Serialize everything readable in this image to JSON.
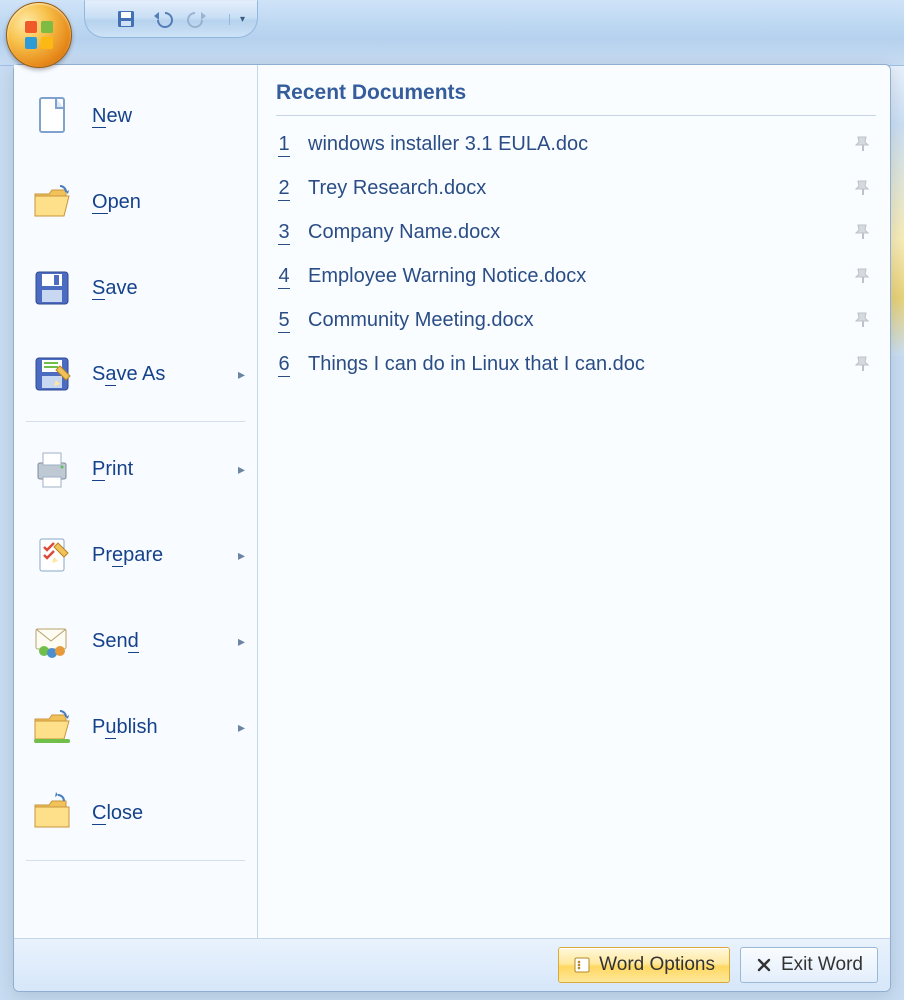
{
  "menu": {
    "items": [
      {
        "label": "New",
        "accel": "N",
        "has_subitems": false,
        "icon": "new-doc"
      },
      {
        "label": "Open",
        "accel": "O",
        "has_subitems": false,
        "icon": "open-folder"
      },
      {
        "label": "Save",
        "accel": "S",
        "has_subitems": false,
        "icon": "save-floppy"
      },
      {
        "label": "Save As",
        "accel": "A",
        "has_subitems": true,
        "icon": "save-as"
      },
      {
        "label": "Print",
        "accel": "P",
        "has_subitems": true,
        "icon": "printer"
      },
      {
        "label": "Prepare",
        "accel": "e",
        "has_subitems": true,
        "icon": "prepare"
      },
      {
        "label": "Send",
        "accel": "d",
        "has_subitems": true,
        "icon": "send"
      },
      {
        "label": "Publish",
        "accel": "u",
        "has_subitems": true,
        "icon": "publish"
      },
      {
        "label": "Close",
        "accel": "C",
        "has_subitems": false,
        "icon": "close-folder"
      }
    ],
    "separators_after": [
      3,
      8
    ]
  },
  "recent_documents": {
    "title": "Recent Documents",
    "items": [
      {
        "index": "1",
        "name": "windows installer 3.1 EULA.doc"
      },
      {
        "index": "2",
        "name": "Trey Research.docx"
      },
      {
        "index": "3",
        "name": "Company Name.docx"
      },
      {
        "index": "4",
        "name": "Employee Warning Notice.docx"
      },
      {
        "index": "5",
        "name": "Community Meeting.docx"
      },
      {
        "index": "6",
        "name": "Things I can do in Linux that I can.doc"
      }
    ]
  },
  "footer": {
    "word_options": "Word Options",
    "exit_word": "Exit Word"
  },
  "qat": {
    "save_tooltip": "Save",
    "undo_tooltip": "Undo",
    "redo_tooltip": "Redo"
  }
}
